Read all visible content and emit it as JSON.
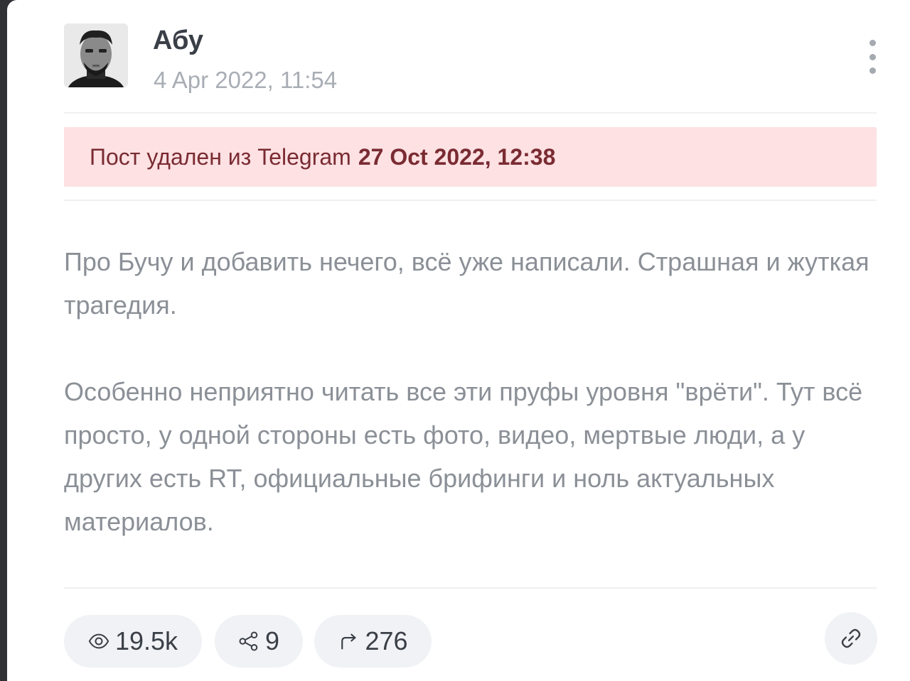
{
  "post": {
    "author": "Абу",
    "timestamp": "4 Apr 2022, 11:54",
    "deleted_notice": {
      "prefix": "Пост удален из Telegram",
      "date": "27 Oct 2022, 12:38"
    },
    "paragraphs": [
      "Про Бучу и добавить нечего, всё уже написали. Страшная и жуткая трагедия.",
      "Особенно неприятно читать все эти пруфы уровня \"врёти\". Тут всё просто, у одной стороны есть фото, видео, мертвые люди, а у других есть RT, официальные брифинги и ноль актуальных материалов."
    ]
  },
  "stats": {
    "views": "19.5k",
    "shares": "9",
    "forwards": "276"
  },
  "icons": {
    "menu": "more-vertical-icon",
    "views": "eye-icon",
    "shares": "share-nodes-icon",
    "forwards": "forward-arrow-icon",
    "link": "link-icon"
  },
  "colors": {
    "deleted_bg": "#fde1e3",
    "deleted_text": "#7a2b32",
    "body_text": "#8b9097",
    "pill_bg": "#f0f2f5"
  }
}
